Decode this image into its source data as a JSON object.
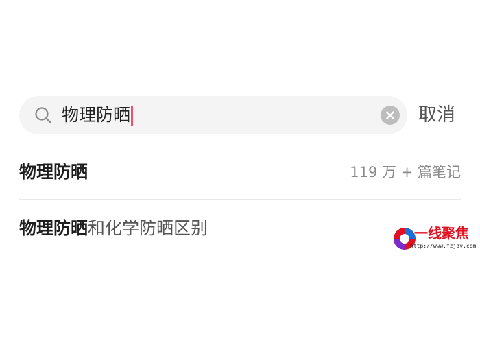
{
  "search": {
    "query": "物理防晒",
    "cancel_label": "取消",
    "icon": "search-icon",
    "clear_icon": "clear-icon",
    "caret_color": "#f0506e"
  },
  "suggestions": [
    {
      "match": "物理防晒",
      "rest": "",
      "count": "119 万 + 篇笔记"
    },
    {
      "match": "物理防晒",
      "rest": "和化学防晒区别",
      "count": ""
    }
  ],
  "watermark": {
    "title": "一线聚焦",
    "url": "http://www.fzjdv.com"
  }
}
